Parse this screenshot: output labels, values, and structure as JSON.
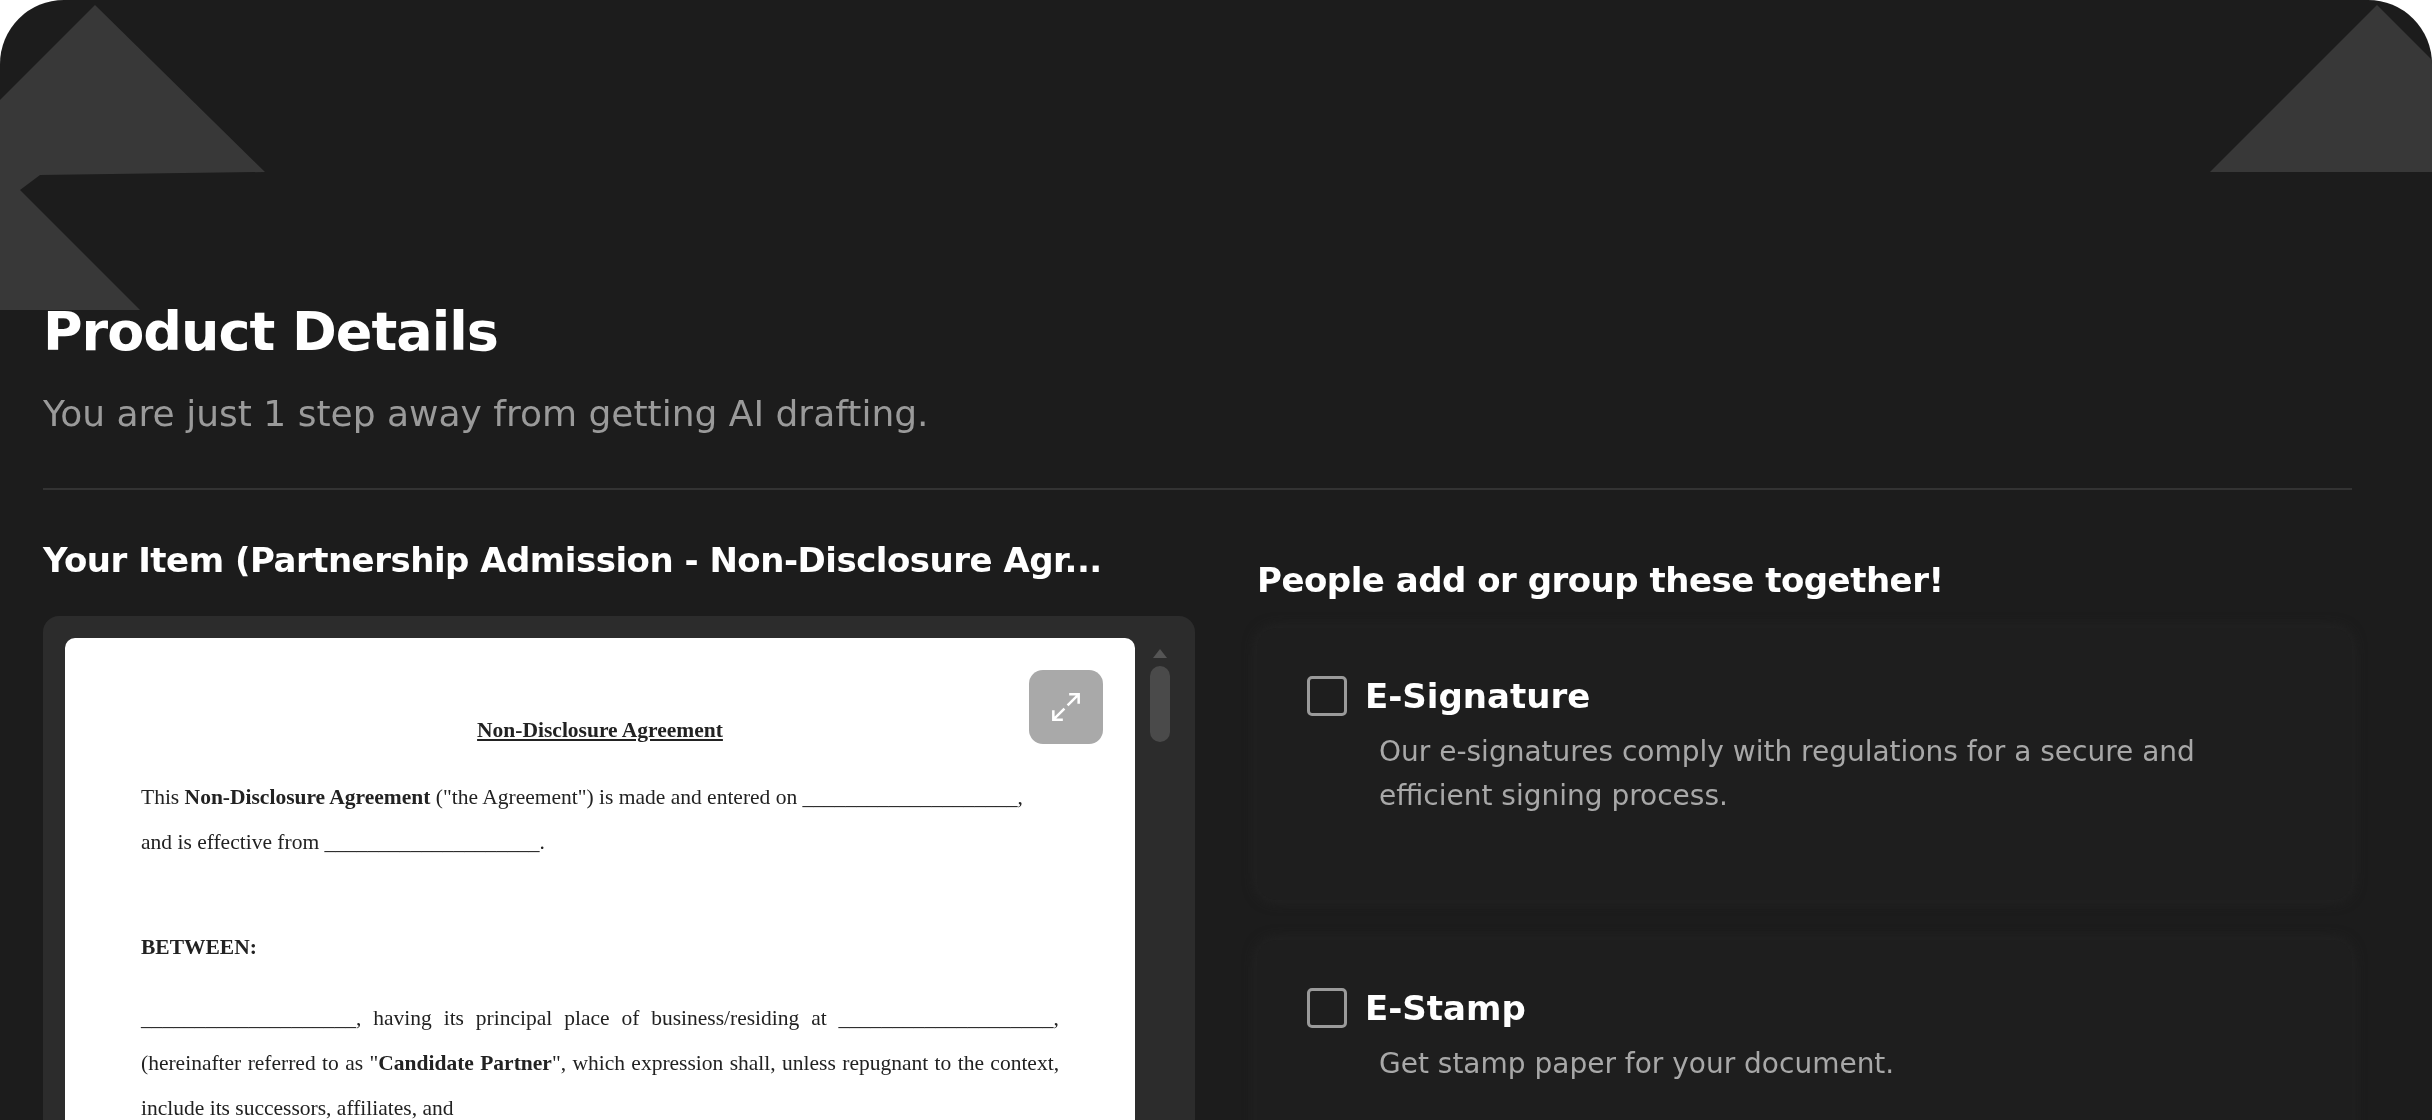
{
  "header": {
    "title": "Product Details",
    "subtitle": "You are just 1 step away from getting AI drafting."
  },
  "item": {
    "heading": "Your Item (Partnership Admission - Non-Disclosure Agr...",
    "document": {
      "title": "Non-Disclosure Agreement",
      "paragraphs": [
        {
          "kind": "text",
          "text": "This **Non-Disclosure Agreement** (\"the Agreement\") is made and entered on ____________________, and is effective from ____________________."
        },
        {
          "kind": "heading",
          "text": "BETWEEN:"
        },
        {
          "kind": "justified",
          "text": "____________________, having its principal place of business/residing at ____________________, (hereinafter referred to as \"**Candidate Partner**\", which expression shall, unless repugnant to the context, include its successors, affiliates, and"
        }
      ]
    }
  },
  "addons": {
    "heading": "People add or group these together!",
    "options": [
      {
        "title": "E-Signature",
        "description": "Our e-signatures comply with regulations for a secure and efficient signing process.",
        "checked": false
      },
      {
        "title": "E-Stamp",
        "description": "Get stamp paper for your document.",
        "checked": false
      }
    ]
  }
}
